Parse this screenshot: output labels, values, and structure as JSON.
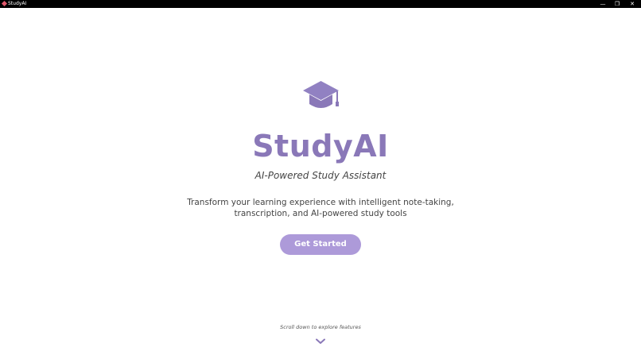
{
  "window": {
    "title": "StudyAI",
    "controls": {
      "minimize": "—",
      "maximize": "❐",
      "close": "✕"
    }
  },
  "hero": {
    "icon": "graduation-cap-icon",
    "title": "StudyAI",
    "tagline": "AI-Powered Study Assistant",
    "description": "Transform your learning experience with intelligent note-taking, transcription, and AI-powered study tools",
    "cta_label": "Get Started",
    "scroll_hint": "Scroll down to explore features",
    "scroll_icon": "chevron-down-icon"
  },
  "colors": {
    "brand": "#8a78b8",
    "button": "#ad9ad9",
    "titlebar": "#000000",
    "text": "#444444"
  }
}
